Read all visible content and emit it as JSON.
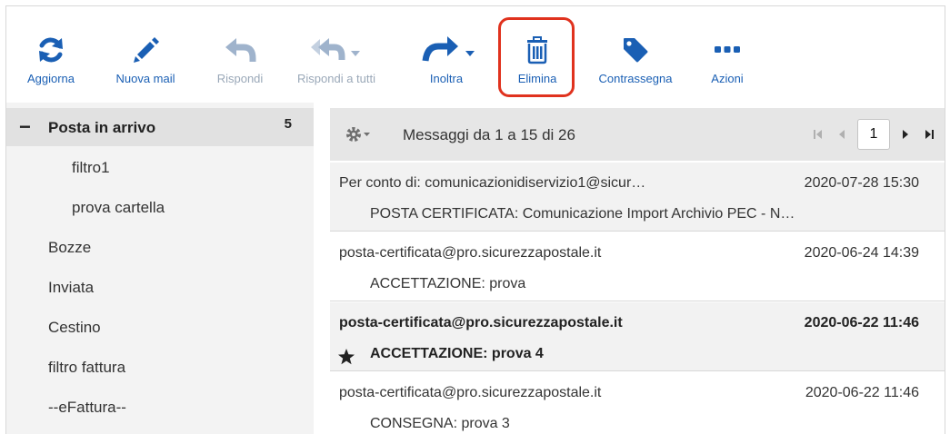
{
  "toolbar": {
    "refresh_label": "Aggiorna",
    "new_mail_label": "Nuova mail",
    "reply_label": "Rispondi",
    "reply_all_label": "Rispondi a tutti",
    "forward_label": "Inoltra",
    "delete_label": "Elimina",
    "flag_label": "Contrassegna",
    "actions_label": "Azioni"
  },
  "sidebar": {
    "inbox": {
      "label": "Posta in arrivo",
      "count": "5",
      "collapse_symbol": "−"
    },
    "folders": [
      {
        "label": "filtro1"
      },
      {
        "label": "prova cartella"
      },
      {
        "label": "Bozze"
      },
      {
        "label": "Inviata"
      },
      {
        "label": "Cestino"
      },
      {
        "label": "filtro fattura"
      },
      {
        "label": "--eFattura--"
      }
    ]
  },
  "list": {
    "info": "Messaggi da 1 a 15 di 26",
    "page": "1"
  },
  "messages": [
    {
      "from": "Per conto di: comunicazionidiservizio1@sicur…",
      "date": "2020-07-28 15:30",
      "subject": "POSTA CERTIFICATA: Comunicazione Import Archivio PEC - N…",
      "unread": false,
      "starred": false
    },
    {
      "from": "posta-certificata@pro.sicurezzapostale.it",
      "date": "2020-06-24 14:39",
      "subject": "ACCETTAZIONE: prova",
      "unread": false,
      "starred": false
    },
    {
      "from": "posta-certificata@pro.sicurezzapostale.it",
      "date": "2020-06-22 11:46",
      "subject": "ACCETTAZIONE: prova 4",
      "unread": true,
      "starred": true
    },
    {
      "from": "posta-certificata@pro.sicurezzapostale.it",
      "date": "2020-06-22 11:46",
      "subject": "CONSEGNA: prova 3",
      "unread": false,
      "starred": false
    }
  ],
  "colors": {
    "accent": "#1a5fb4",
    "disabled": "#9aa8b8",
    "highlight": "#e0321e",
    "sidebar_bg": "#f3f3f3",
    "selected_folder_bg": "#e1e1e1"
  },
  "icons": {
    "refresh": "refresh-icon",
    "new_mail": "pencil-icon",
    "reply": "reply-icon",
    "reply_all": "reply-all-icon",
    "forward": "forward-icon",
    "delete": "trash-icon",
    "flag": "tag-icon",
    "actions": "more-icon",
    "settings": "gear-icon",
    "star": "star-icon"
  }
}
